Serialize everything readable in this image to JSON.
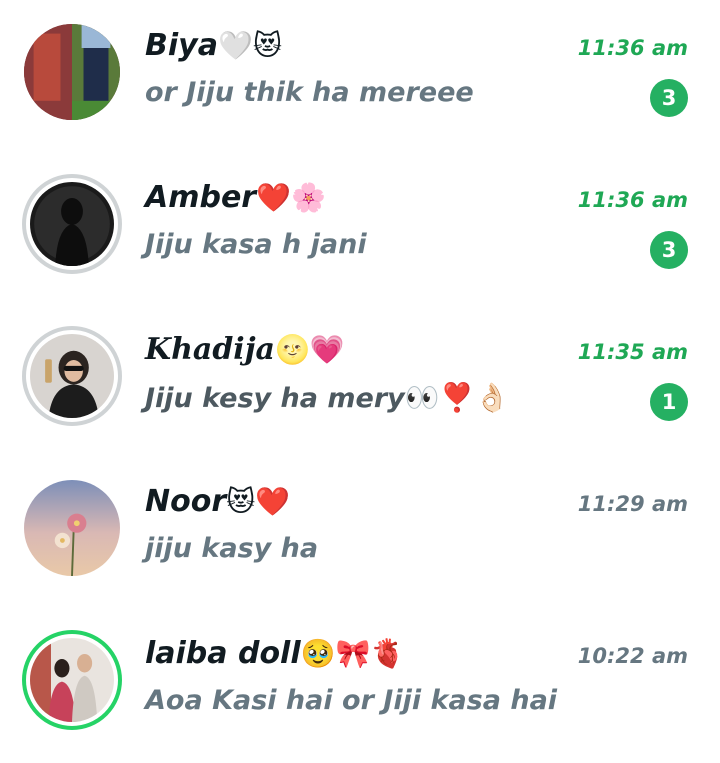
{
  "chats": [
    {
      "name": "Biya",
      "name_emoji": "🤍😻",
      "preview": "or Jiju thik ha mereee",
      "preview_emoji": "",
      "time": "11:36 am",
      "unread": "3",
      "avatar_icon": "contact-photo"
    },
    {
      "name": "Amber",
      "name_emoji": "❤️🌸",
      "preview": "Jiju kasa h jani",
      "preview_emoji": "",
      "time": "11:36 am",
      "unread": "3",
      "avatar_icon": "contact-photo"
    },
    {
      "name": "Khadija",
      "name_emoji": "🌝💗",
      "preview": "Jiju kesy ha mery",
      "preview_emoji": "👀❣️👌🏻",
      "time": "11:35 am",
      "unread": "1",
      "avatar_icon": "contact-photo"
    },
    {
      "name": "Noor",
      "name_emoji": "😻❤️",
      "preview": "jiju kasy ha",
      "preview_emoji": "",
      "time": "11:29 am",
      "unread": "",
      "avatar_icon": "contact-photo"
    },
    {
      "name": "laiba doll",
      "name_emoji": "🥹🎀🫀",
      "preview": "Aoa Kasi hai or Jiji kasa hai",
      "preview_emoji": "",
      "time": "10:22 am",
      "unread": "",
      "avatar_icon": "contact-photo"
    }
  ],
  "colors": {
    "accent": "#25d366",
    "unread_time": "#1fa855",
    "badge": "#25b062",
    "text": "#111b21",
    "muted": "#667781"
  }
}
